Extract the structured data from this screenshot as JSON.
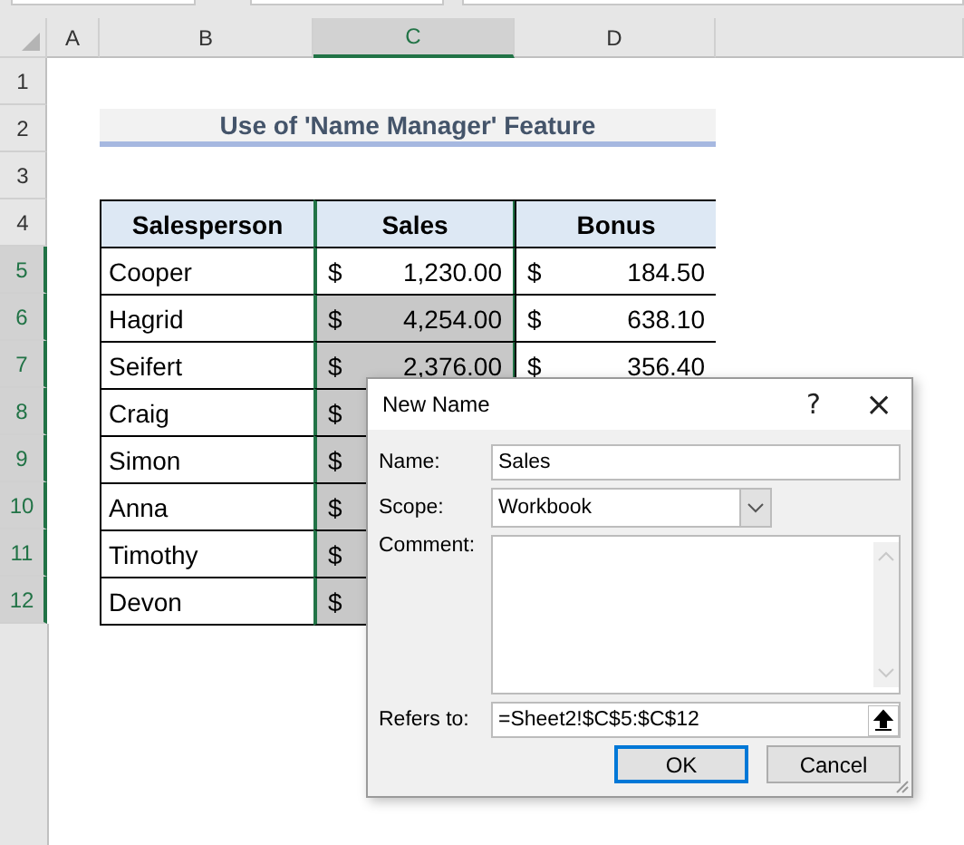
{
  "columns": [
    {
      "label": "A",
      "selected": false
    },
    {
      "label": "B",
      "selected": false
    },
    {
      "label": "C",
      "selected": true
    },
    {
      "label": "D",
      "selected": false
    }
  ],
  "row_numbers": [
    {
      "label": "1",
      "selected": false
    },
    {
      "label": "2",
      "selected": false
    },
    {
      "label": "3",
      "selected": false
    },
    {
      "label": "4",
      "selected": false
    },
    {
      "label": "5",
      "selected": true
    },
    {
      "label": "6",
      "selected": true
    },
    {
      "label": "7",
      "selected": true
    },
    {
      "label": "8",
      "selected": true
    },
    {
      "label": "9",
      "selected": true
    },
    {
      "label": "10",
      "selected": true
    },
    {
      "label": "11",
      "selected": true
    },
    {
      "label": "12",
      "selected": true
    }
  ],
  "title": "Use of 'Name Manager' Feature",
  "table": {
    "columns": [
      "Salesperson",
      "Sales",
      "Bonus"
    ],
    "rows": [
      {
        "name": "Cooper",
        "sales": {
          "symbol": "$",
          "amount": "1,230.00",
          "selected": false
        },
        "bonus": {
          "symbol": "$",
          "amount": "184.50"
        }
      },
      {
        "name": "Hagrid",
        "sales": {
          "symbol": "$",
          "amount": "4,254.00",
          "selected": true
        },
        "bonus": {
          "symbol": "$",
          "amount": "638.10"
        }
      },
      {
        "name": "Seifert",
        "sales": {
          "symbol": "$",
          "amount": "2,376.00",
          "selected": true
        },
        "bonus": {
          "symbol": "$",
          "amount": "356.40"
        }
      },
      {
        "name": "Craig",
        "sales": {
          "symbol": "$",
          "selected": true
        }
      },
      {
        "name": "Simon",
        "sales": {
          "symbol": "$",
          "selected": true
        }
      },
      {
        "name": "Anna",
        "sales": {
          "symbol": "$",
          "selected": true
        }
      },
      {
        "name": "Timothy",
        "sales": {
          "symbol": "$",
          "selected": true
        }
      },
      {
        "name": "Devon",
        "sales": {
          "symbol": "$",
          "selected": true
        }
      }
    ]
  },
  "dialog": {
    "title": "New Name",
    "help": "?",
    "close": "×",
    "name_label": "Name:",
    "name_value": "Sales",
    "scope_label": "Scope:",
    "scope_value": "Workbook",
    "comment_label": "Comment:",
    "refers_label": "Refers to:",
    "refers_value": "=Sheet2!$C$5:$C$12",
    "buttons": [
      {
        "label": "OK",
        "default": true
      },
      {
        "label": "Cancel",
        "default": false
      }
    ]
  }
}
